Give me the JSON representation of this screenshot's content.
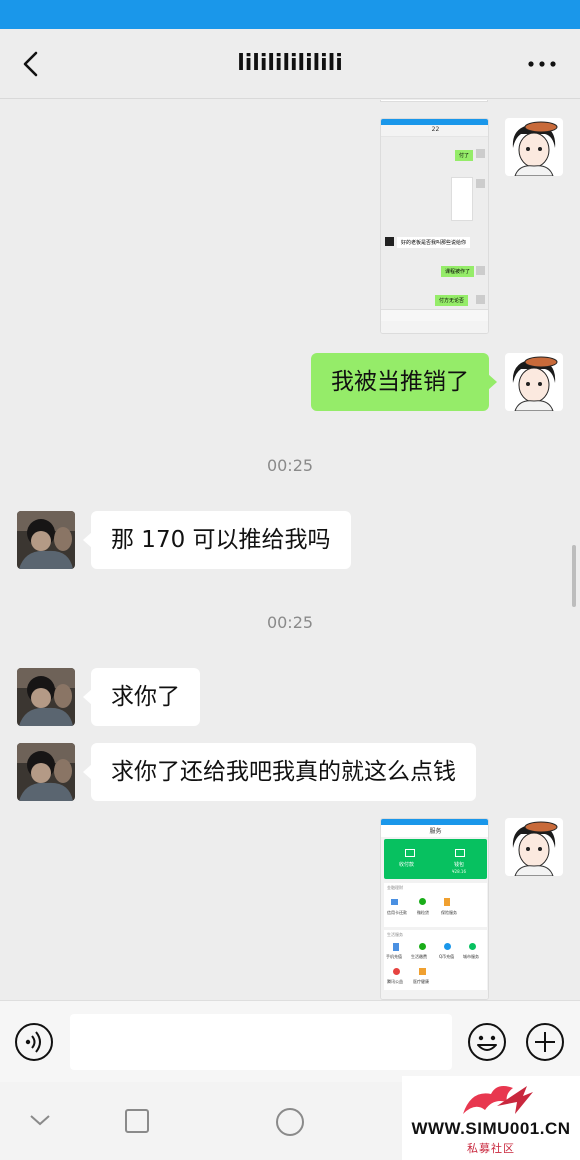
{
  "header": {
    "title": "lilililililili"
  },
  "messages": {
    "m1": {
      "text": "我被当推销了"
    },
    "t1": {
      "text": "00:25"
    },
    "m2": {
      "text": "那 170 可以推给我吗"
    },
    "t2": {
      "text": "00:25"
    },
    "m3": {
      "text": "求你了"
    },
    "m4": {
      "text": "求你了还给我吧我真的就这么点钱"
    }
  },
  "screenshot1": {
    "top_title": "22",
    "lines": [
      "付了",
      "好的老板是否我叫那些说给你",
      "课程被作了",
      "付方无论否"
    ]
  },
  "screenshot2": {
    "title": "服务",
    "pay_label": "收付款",
    "wallet_label": "钱包",
    "wallet_amount": "¥28.16",
    "section1": "金融理财",
    "section2": "生活服务",
    "grid1": [
      "信用卡还款",
      "微粒贷",
      "保险服务"
    ],
    "grid2": [
      "手机充值",
      "生活缴费",
      "Q币充值",
      "城市服务"
    ],
    "grid3": [
      "腾讯公益",
      "医疗健康"
    ]
  },
  "input": {
    "placeholder": ""
  },
  "watermark": {
    "site": "WWW.SIMU001.CN",
    "sub": "私募社区"
  },
  "colors": {
    "status_bar": "#1a97ea",
    "my_bubble": "#95ec69",
    "wechat_green": "#07c160"
  }
}
